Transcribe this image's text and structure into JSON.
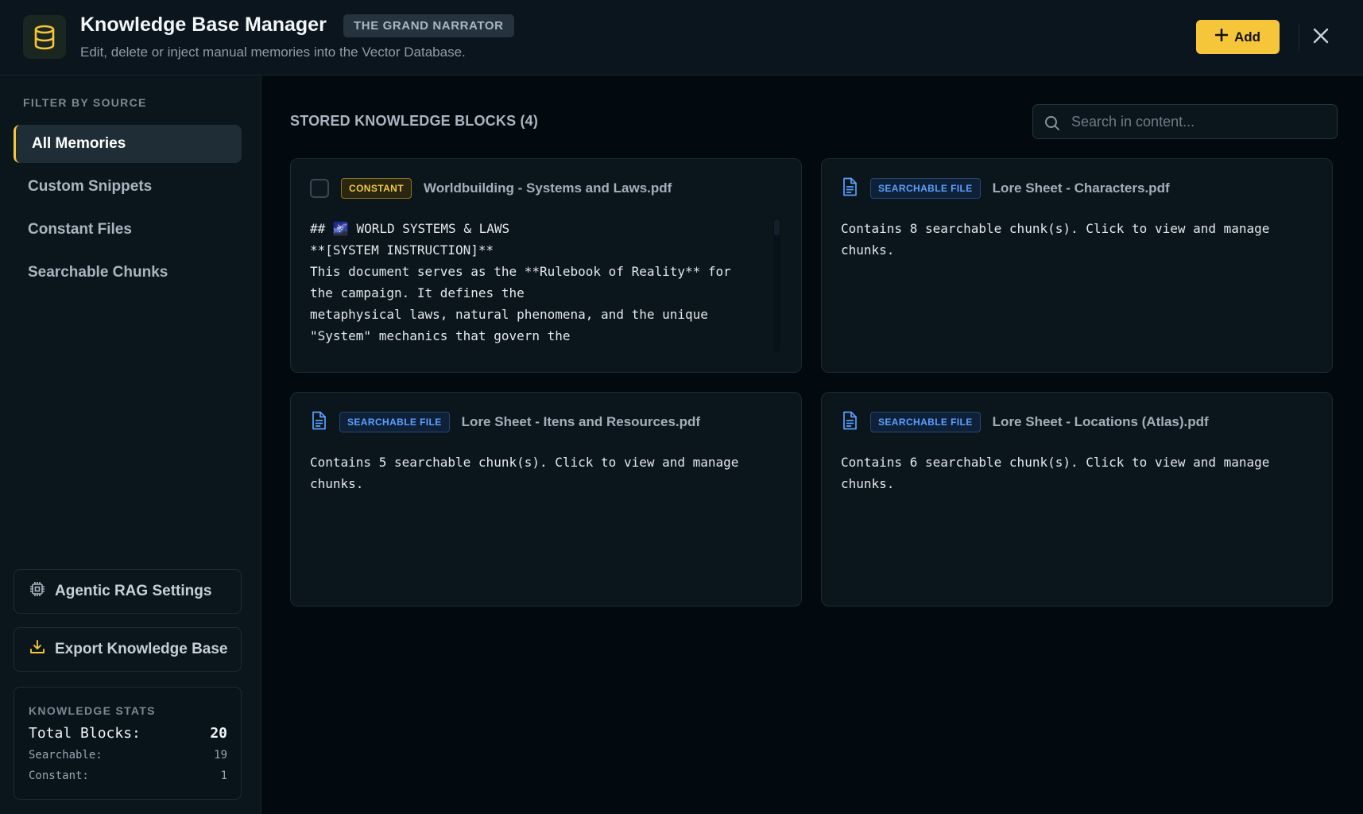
{
  "header": {
    "title": "Knowledge Base Manager",
    "badge": "THE GRAND NARRATOR",
    "subtitle": "Edit, delete or inject manual memories into the Vector Database.",
    "add_label": "Add",
    "logo_icon": "database-icon",
    "accent_color": "#f6c63a"
  },
  "sidebar": {
    "filter_heading": "FILTER BY SOURCE",
    "items": [
      {
        "label": "All Memories",
        "active": true
      },
      {
        "label": "Custom Snippets",
        "active": false
      },
      {
        "label": "Constant Files",
        "active": false
      },
      {
        "label": "Searchable Chunks",
        "active": false
      }
    ],
    "rag_settings_label": "Agentic RAG Settings",
    "export_label": "Export Knowledge Base",
    "stats": {
      "heading": "KNOWLEDGE STATS",
      "total_label": "Total Blocks:",
      "total_value": "20",
      "searchable_label": "Searchable:",
      "searchable_value": "19",
      "constant_label": "Constant:",
      "constant_value": "1"
    }
  },
  "main": {
    "section_title": "STORED KNOWLEDGE BLOCKS (4)",
    "search_placeholder": "Search in content...",
    "cards": [
      {
        "badge": "CONSTANT",
        "title": "Worldbuilding - Systems and Laws.pdf",
        "content": "## 🌌 WORLD SYSTEMS & LAWS\n**[SYSTEM INSTRUCTION]**\nThis document serves as the **Rulebook of Reality** for the campaign. It defines the\nmetaphysical laws, natural phenomena, and the unique\n\"System\" mechanics that govern the\nuniverse. The narrative AI refers to this to ensure consistency."
      },
      {
        "badge": "SEARCHABLE FILE",
        "title": "Lore Sheet - Characters.pdf",
        "content": "Contains 8 searchable chunk(s). Click to view and manage chunks."
      },
      {
        "badge": "SEARCHABLE FILE",
        "title": "Lore Sheet - Itens and Resources.pdf",
        "content": "Contains 5 searchable chunk(s). Click to view and manage chunks."
      },
      {
        "badge": "SEARCHABLE FILE",
        "title": "Lore Sheet - Locations (Atlas).pdf",
        "content": "Contains 6 searchable chunk(s). Click to view and manage chunks."
      }
    ]
  }
}
